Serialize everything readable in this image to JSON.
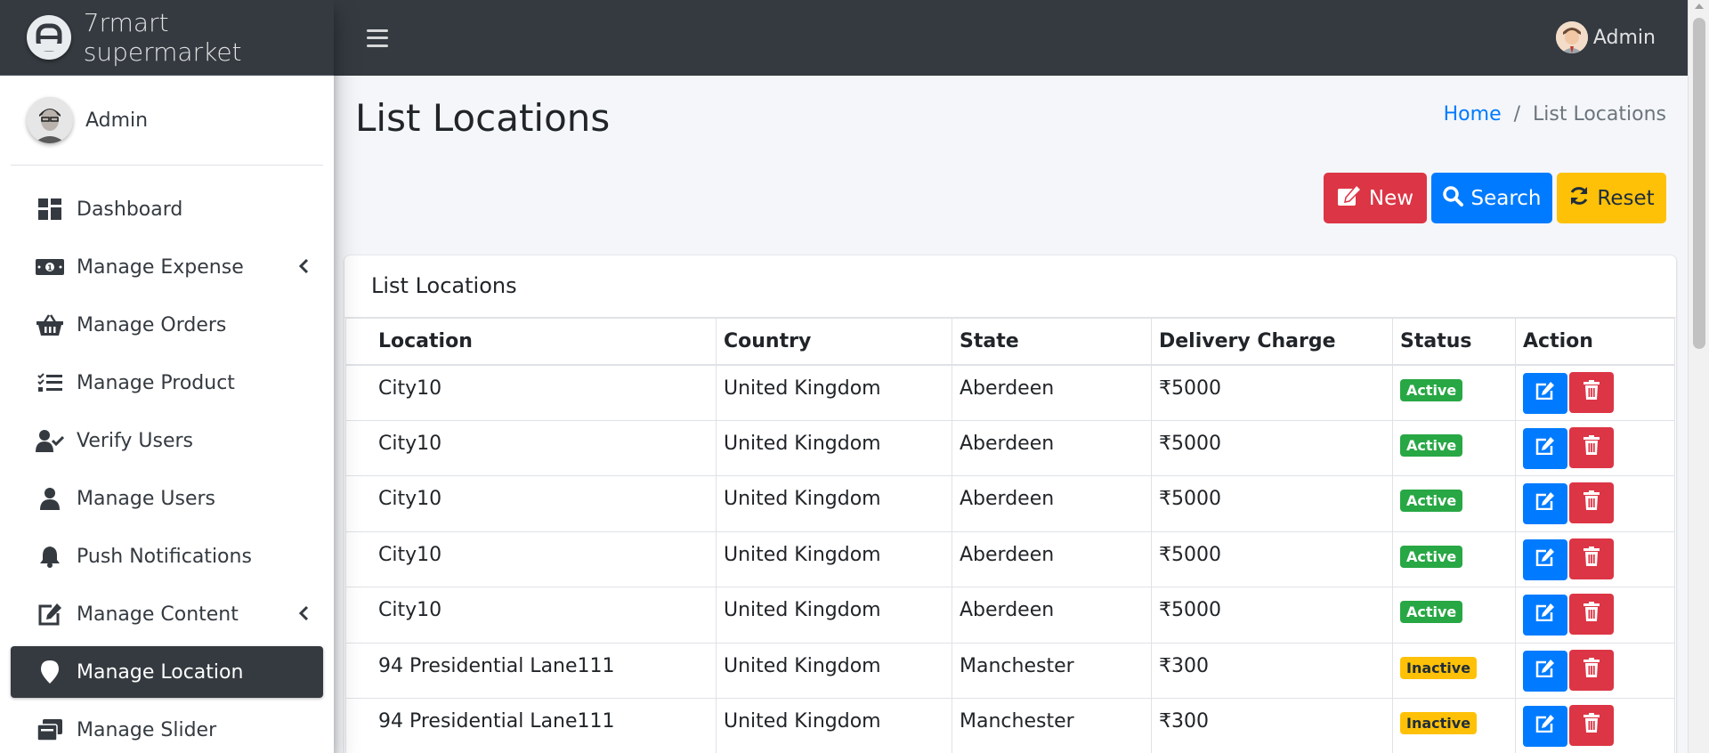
{
  "brand": {
    "name": "7rmart supermarket"
  },
  "topbar": {
    "user_name": "Admin"
  },
  "sidebar": {
    "user_name": "Admin",
    "items": [
      {
        "label": "Dashboard",
        "icon": "dashboard-icon"
      },
      {
        "label": "Manage Expense",
        "icon": "money-icon",
        "has_submenu": true
      },
      {
        "label": "Manage Orders",
        "icon": "basket-icon"
      },
      {
        "label": "Manage Product",
        "icon": "list-check-icon"
      },
      {
        "label": "Verify Users",
        "icon": "user-check-icon"
      },
      {
        "label": "Manage Users",
        "icon": "user-icon"
      },
      {
        "label": "Push Notifications",
        "icon": "bell-icon"
      },
      {
        "label": "Manage Content",
        "icon": "edit-icon",
        "has_submenu": true
      },
      {
        "label": "Manage Location",
        "icon": "map-marker-icon",
        "active": true
      },
      {
        "label": "Manage Slider",
        "icon": "images-icon"
      }
    ]
  },
  "page": {
    "title": "List Locations",
    "breadcrumb": {
      "home": "Home",
      "separator": "/",
      "current": "List Locations"
    }
  },
  "toolbar": {
    "new_label": "New",
    "search_label": "Search",
    "reset_label": "Reset"
  },
  "card": {
    "title": "List Locations"
  },
  "table": {
    "headers": [
      "Location",
      "Country",
      "State",
      "Delivery Charge",
      "Status",
      "Action"
    ],
    "rows": [
      {
        "location": "City10",
        "country": "United Kingdom",
        "state": "Aberdeen",
        "charge": "₹5000",
        "status": "Active"
      },
      {
        "location": "City10",
        "country": "United Kingdom",
        "state": "Aberdeen",
        "charge": "₹5000",
        "status": "Active"
      },
      {
        "location": "City10",
        "country": "United Kingdom",
        "state": "Aberdeen",
        "charge": "₹5000",
        "status": "Active"
      },
      {
        "location": "City10",
        "country": "United Kingdom",
        "state": "Aberdeen",
        "charge": "₹5000",
        "status": "Active"
      },
      {
        "location": "City10",
        "country": "United Kingdom",
        "state": "Aberdeen",
        "charge": "₹5000",
        "status": "Active"
      },
      {
        "location": "94 Presidential Lane111",
        "country": "United Kingdom",
        "state": "Manchester",
        "charge": "₹300",
        "status": "Inactive"
      },
      {
        "location": "94 Presidential Lane111",
        "country": "United Kingdom",
        "state": "Manchester",
        "charge": "₹300",
        "status": "Inactive"
      }
    ]
  },
  "colors": {
    "dark": "#343a40",
    "primary": "#007bff",
    "danger": "#dc3545",
    "warning": "#ffc107",
    "success": "#28a745"
  }
}
